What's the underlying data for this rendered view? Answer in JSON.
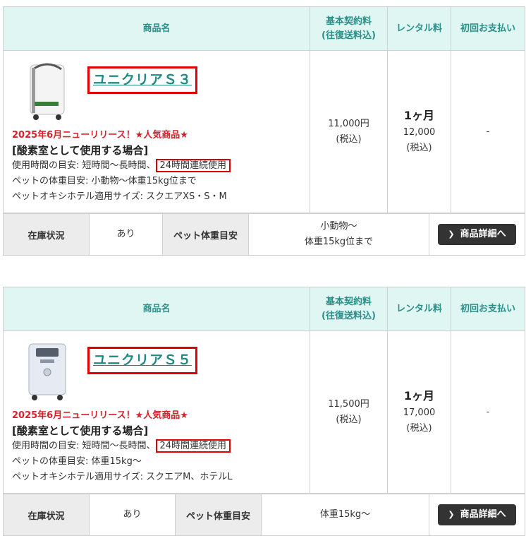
{
  "headers": {
    "product": "商品名",
    "basic_fee_line1": "基本契約料",
    "basic_fee_line2": "(往復送料込)",
    "rental_fee": "レンタル料",
    "first_payment": "初回お支払い"
  },
  "products": [
    {
      "name": "ユニクリアＳ３",
      "new_release": "2025年6月ニューリリース！★人気商品★",
      "usage_title": "[酸素室として使用する場合]",
      "usage_time_prefix": "使用時間の目安: 短時間〜長時間、",
      "usage_time_highlight": "24時間連続使用",
      "pet_weight": "ペットの体重目安: 小動物〜体重15kg位まで",
      "hotel_size": "ペットオキシホテル適用サイズ: スクエアXS・S・M",
      "basic_fee": "11,000円",
      "basic_tax": "(税込)",
      "rental_period": "1ヶ月",
      "rental_price": "12,000",
      "rental_tax": "(税込)",
      "first_payment": "-",
      "stock_label": "在庫状況",
      "stock_value": "あり",
      "pet_weight_label": "ペット体重目安",
      "pet_weight_value_line1": "小動物〜",
      "pet_weight_value_line2": "体重15kg位まで",
      "detail_button": "商品詳細へ"
    },
    {
      "name": "ユニクリアＳ５",
      "new_release": "2025年6月ニューリリース！★人気商品★",
      "usage_title": "[酸素室として使用する場合]",
      "usage_time_prefix": "使用時間の目安: 短時間〜長時間、",
      "usage_time_highlight": "24時間連続使用",
      "pet_weight": "ペットの体重目安: 体重15kg〜",
      "hotel_size": "ペットオキシホテル適用サイズ: スクエアM、ホテルL",
      "basic_fee": "11,500円",
      "basic_tax": "(税込)",
      "rental_period": "1ヶ月",
      "rental_price": "17,000",
      "rental_tax": "(税込)",
      "first_payment": "-",
      "stock_label": "在庫状況",
      "stock_value": "あり",
      "pet_weight_label": "ペット体重目安",
      "pet_weight_value_line1": "体重15kg〜",
      "pet_weight_value_line2": "",
      "detail_button": "商品詳細へ"
    }
  ],
  "colors": {
    "header_bg": "#dff6f2",
    "header_text": "#2a8f88",
    "accent_red": "#e00000",
    "link": "#1e8a82"
  }
}
